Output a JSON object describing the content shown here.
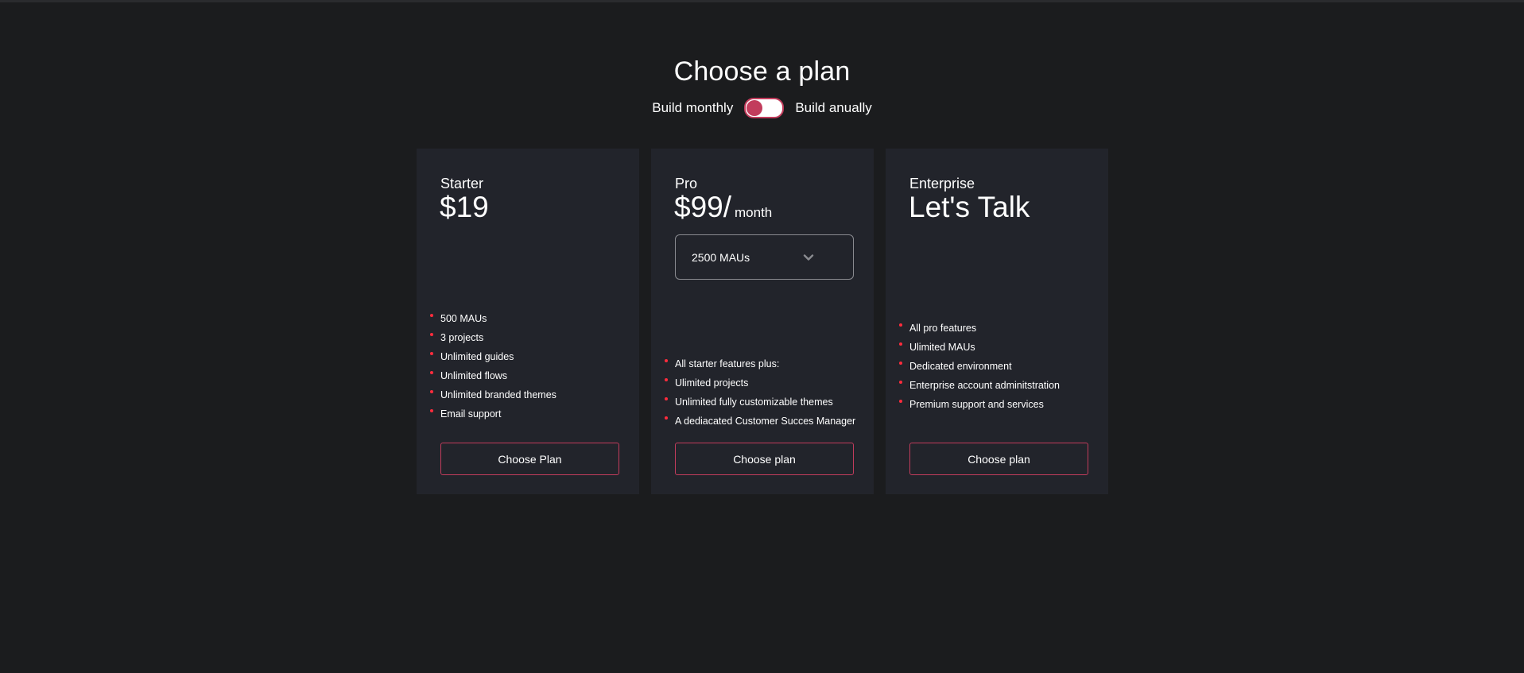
{
  "header": {
    "title": "Choose a plan"
  },
  "billing_toggle": {
    "left_label": "Build monthly",
    "right_label": "Build anually",
    "active_side": "monthly",
    "accent_color": "#c23c5c"
  },
  "plans": [
    {
      "name": "Starter",
      "price": "$19",
      "features": [
        "500 MAUs",
        "3 projects",
        "Unlimited guides",
        "Unlimited flows",
        "Unlimited branded themes",
        "Email support"
      ],
      "button_label": "Choose Plan"
    },
    {
      "name": "Pro",
      "price": "$99/",
      "price_period": "month",
      "mau_select": {
        "value": "2500 MAUs",
        "icon": "chevron-down-icon"
      },
      "features": [
        "All starter features plus:",
        "Ulimited projects",
        "Unlimited fully customizable themes",
        "A dediacated Customer Succes Manager"
      ],
      "button_label": "Choose plan"
    },
    {
      "name": "Enterprise",
      "price": "Let's Talk",
      "features": [
        "All pro features",
        "Ulimited MAUs",
        "Dedicated environment",
        "Enterprise account adminitstration",
        "Premium support and services"
      ],
      "button_label": "Choose plan"
    }
  ],
  "colors": {
    "background": "#1b1c1e",
    "card": "#22242b",
    "bullet": "#ff2c3d",
    "button_border": "#c23c5c"
  }
}
